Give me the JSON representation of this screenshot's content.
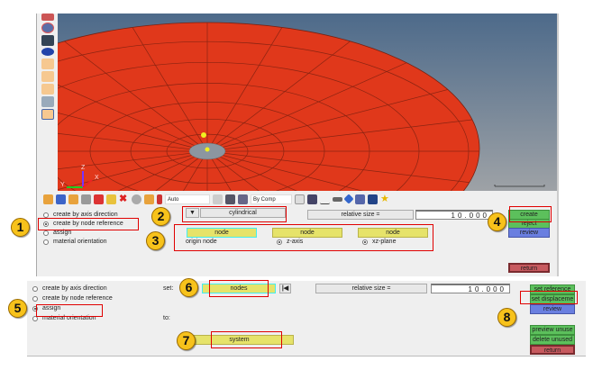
{
  "viewport": {
    "colors": {
      "mesh": "#e0381b",
      "sky_top": "#4d6a8a",
      "sky_bottom": "#9ea2a6",
      "hole": "#8c96a0",
      "node": "#f0f020"
    },
    "axis_labels": [
      "Z",
      "X",
      "Y"
    ]
  },
  "toolbar": {
    "auto_select": "Auto",
    "comp_select": "By Comp"
  },
  "upper_panel": {
    "radios": [
      {
        "label": "create by axis direction",
        "checked": false
      },
      {
        "label": "create by node reference",
        "checked": true
      },
      {
        "label": "assign",
        "checked": false
      },
      {
        "label": "material orientation",
        "checked": false
      }
    ],
    "type_dropdown": "cylindrical",
    "relative_size_label": "relative size =",
    "relative_size_value": "10.000",
    "node_buttons": [
      "node",
      "node",
      "node"
    ],
    "origin_label": "origin node",
    "z_axis_label": "z-axis",
    "xz_plane_label": "xz-plane",
    "actions": {
      "create": "create",
      "reject": "reject",
      "review": "review",
      "return": "return"
    }
  },
  "lower_panel": {
    "radios": [
      {
        "label": "create by axis direction",
        "checked": false
      },
      {
        "label": "create by node reference",
        "checked": false
      },
      {
        "label": "assign",
        "checked": true
      },
      {
        "label": "material orientation",
        "checked": false
      }
    ],
    "set_label": "set:",
    "to_label": "to:",
    "nodes_button": "nodes",
    "system_button": "system",
    "relative_size_label": "relative size =",
    "relative_size_value": "10.000",
    "actions": {
      "set_reference": "set reference",
      "set_displacement": "set displaceme",
      "review": "review",
      "preview_unused": "preview unuse",
      "delete_unused": "delete unused",
      "return": "return"
    }
  },
  "callouts": [
    "1",
    "2",
    "3",
    "4",
    "5",
    "6",
    "7",
    "8"
  ]
}
